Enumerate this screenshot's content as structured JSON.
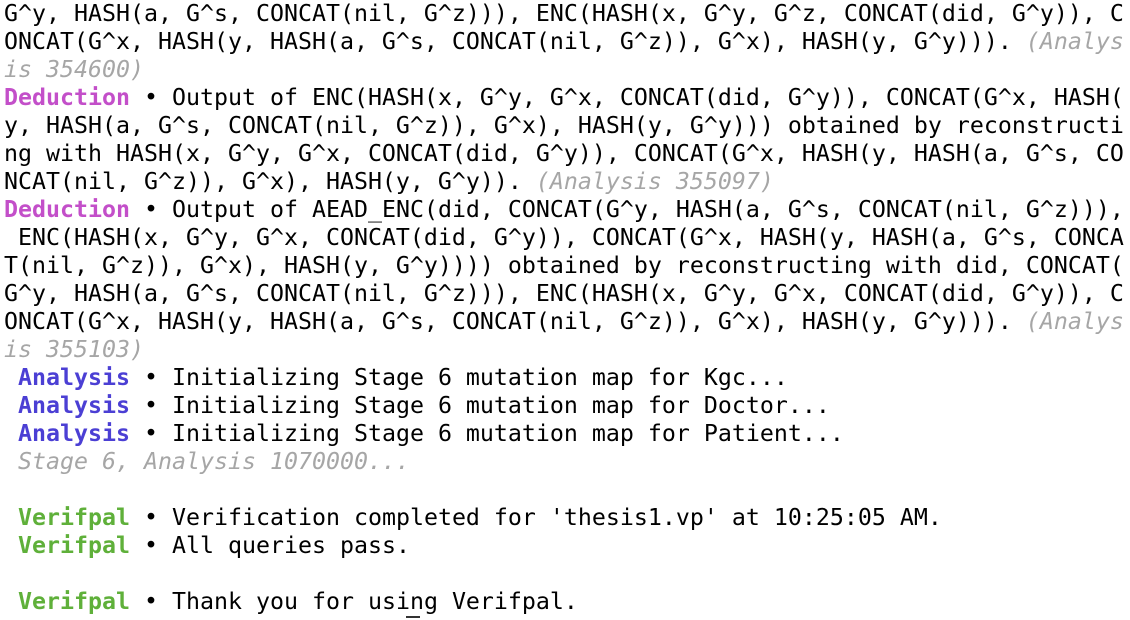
{
  "terminal": {
    "colors": {
      "deduction": "#c34fc9",
      "analysis": "#4b3fd4",
      "verifpal": "#5fb03a",
      "note": "#a6a6a6",
      "text": "#000000",
      "background": "#ffffff"
    },
    "lines": [
      {
        "text": "G^y, HASH(a, G^s, CONCAT(nil, G^z))), ENC(HASH(x, G^y, G^z, CONCAT(did, G^y)), C"
      },
      {
        "text": "ONCAT(G^x, HASH(y, HASH(a, G^s, CONCAT(nil, G^z)), G^x), HASH(y, G^y))). ",
        "note": "(Analys"
      },
      {
        "note": "is 354600)"
      },
      {
        "tag": "Deduction",
        "tag_type": "deduction",
        "bullet": " • ",
        "text": "Output of ENC(HASH(x, G^y, G^x, CONCAT(did, G^y)), CONCAT(G^x, HASH("
      },
      {
        "text": "y, HASH(a, G^s, CONCAT(nil, G^z)), G^x), HASH(y, G^y))) obtained by reconstructi"
      },
      {
        "text": "ng with HASH(x, G^y, G^x, CONCAT(did, G^y)), CONCAT(G^x, HASH(y, HASH(a, G^s, CO"
      },
      {
        "text": "NCAT(nil, G^z)), G^x), HASH(y, G^y)). ",
        "note": "(Analysis 355097)"
      },
      {
        "tag": "Deduction",
        "tag_type": "deduction",
        "bullet": " • ",
        "text": "Output of AEAD_ENC(did, CONCAT(G^y, HASH(a, G^s, CONCAT(nil, G^z))),"
      },
      {
        "text": " ENC(HASH(x, G^y, G^x, CONCAT(did, G^y)), CONCAT(G^x, HASH(y, HASH(a, G^s, CONCA"
      },
      {
        "text": "T(nil, G^z)), G^x), HASH(y, G^y)))) obtained by reconstructing with did, CONCAT("
      },
      {
        "text": "G^y, HASH(a, G^s, CONCAT(nil, G^z))), ENC(HASH(x, G^y, G^x, CONCAT(did, G^y)), C"
      },
      {
        "text": "ONCAT(G^x, HASH(y, HASH(a, G^s, CONCAT(nil, G^z)), G^x), HASH(y, G^y))). ",
        "note": "(Analys"
      },
      {
        "note": "is 355103)"
      },
      {
        "tag": " Analysis",
        "tag_type": "analysis",
        "bullet": " • ",
        "text": "Initializing Stage 6 mutation map for Kgc..."
      },
      {
        "tag": " Analysis",
        "tag_type": "analysis",
        "bullet": " • ",
        "text": "Initializing Stage 6 mutation map for Doctor..."
      },
      {
        "tag": " Analysis",
        "tag_type": "analysis",
        "bullet": " • ",
        "text": "Initializing Stage 6 mutation map for Patient..."
      },
      {
        "note": " Stage 6, Analysis 1070000..."
      },
      {
        "text": ""
      },
      {
        "tag": " Verifpal",
        "tag_type": "verifpal",
        "bullet": " • ",
        "text": "Verification completed for 'thesis1.vp' at 10:25:05 AM."
      },
      {
        "tag": " Verifpal",
        "tag_type": "verifpal",
        "bullet": " • ",
        "text": "All queries pass."
      },
      {
        "text": ""
      },
      {
        "tag": " Verifpal",
        "tag_type": "verifpal",
        "bullet": " • ",
        "text": "Thank you for using Verifpal."
      }
    ]
  }
}
